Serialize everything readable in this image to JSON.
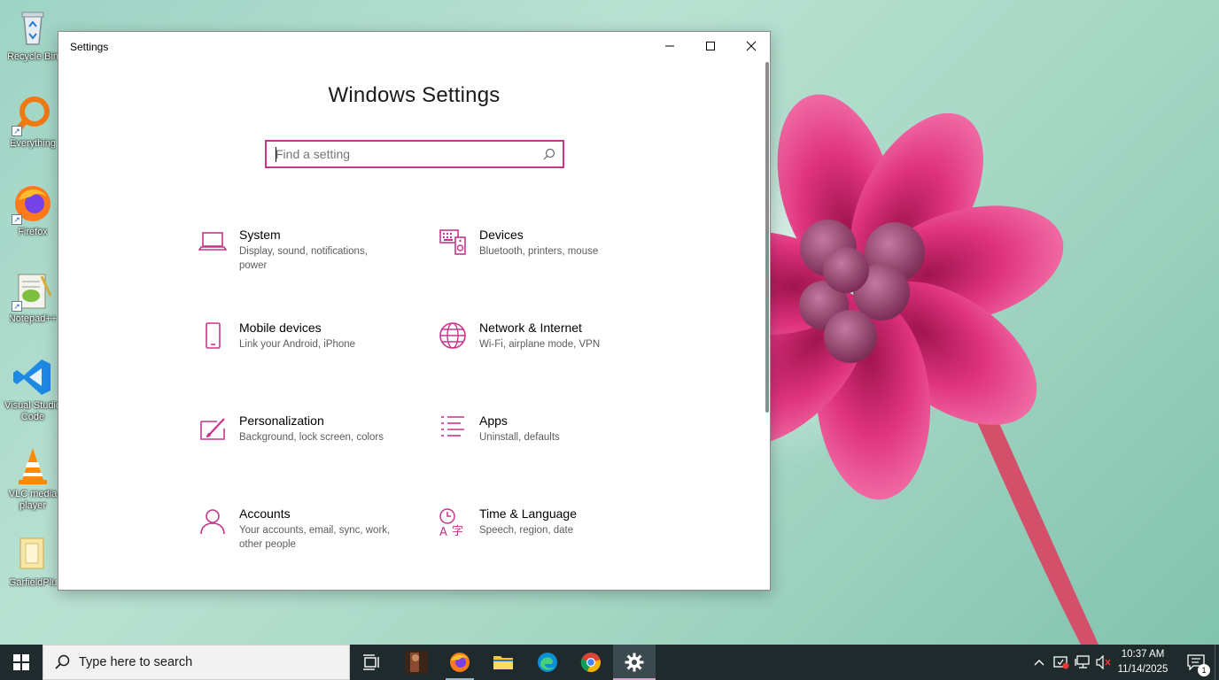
{
  "desktop": {
    "icons": [
      {
        "label": "Recycle Bin"
      },
      {
        "label": "Everything"
      },
      {
        "label": "Firefox"
      },
      {
        "label": "Notepad++"
      },
      {
        "label": "Visual Studio Code"
      },
      {
        "label": "VLC media player"
      },
      {
        "label": "GarfieldPlu"
      }
    ]
  },
  "window": {
    "title": "Settings",
    "heading": "Windows Settings",
    "search_placeholder": "Find a setting",
    "accent_color": "#c9348a",
    "tiles": [
      {
        "name": "System",
        "description": "Display, sound, notifications, power",
        "icon": "laptop-icon"
      },
      {
        "name": "Devices",
        "description": "Bluetooth, printers, mouse",
        "icon": "keyboard-speaker-icon"
      },
      {
        "name": "Mobile devices",
        "description": "Link your Android, iPhone",
        "icon": "phone-icon"
      },
      {
        "name": "Network & Internet",
        "description": "Wi-Fi, airplane mode, VPN",
        "icon": "globe-icon"
      },
      {
        "name": "Personalization",
        "description": "Background, lock screen, colors",
        "icon": "paint-brush-icon"
      },
      {
        "name": "Apps",
        "description": "Uninstall, defaults",
        "icon": "app-list-icon"
      },
      {
        "name": "Accounts",
        "description": "Your accounts, email, sync, work, other people",
        "icon": "person-icon"
      },
      {
        "name": "Time & Language",
        "description": "Speech, region, date",
        "icon": "time-language-icon"
      }
    ]
  },
  "taskbar": {
    "search_placeholder": "Type here to search",
    "time": "10:37 AM",
    "date": "11/14/2025",
    "notification_count": "1"
  }
}
